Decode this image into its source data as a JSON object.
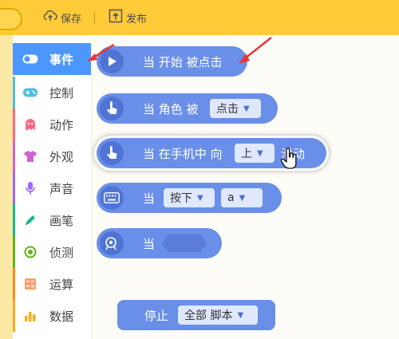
{
  "toolbar": {
    "save_label": "保存",
    "publish_label": "发布",
    "icon_save": "cloud-upload-icon",
    "icon_publish": "publish-icon"
  },
  "sidebar": {
    "items": [
      {
        "label": "事件",
        "icon": "toggle-icon",
        "color": "#4c97ff",
        "active": true
      },
      {
        "label": "控制",
        "icon": "gamepad-icon",
        "color": "#4cbfe6"
      },
      {
        "label": "动作",
        "icon": "ghost-icon",
        "color": "#ff6680"
      },
      {
        "label": "外观",
        "icon": "shirt-icon",
        "color": "#cf63cf"
      },
      {
        "label": "声音",
        "icon": "microphone-icon",
        "color": "#9966ff"
      },
      {
        "label": "画笔",
        "icon": "pen-icon",
        "color": "#0fbd8c"
      },
      {
        "label": "侦测",
        "icon": "target-icon",
        "color": "#5cb712"
      },
      {
        "label": "运算",
        "icon": "calculator-icon",
        "color": "#ff8c1a"
      },
      {
        "label": "数据",
        "icon": "bar-chart-icon",
        "color": "#ffab19"
      }
    ]
  },
  "blocks": {
    "start": {
      "text": "当 开始 被点击"
    },
    "sprite_click": {
      "text1": "当 角色 被",
      "dropdown": "点击"
    },
    "swipe": {
      "text1": "当 在手机中 向",
      "dropdown": "上",
      "text2": "滑动"
    },
    "key": {
      "text1": "当",
      "dropdown1": "按下",
      "dropdown2": "a"
    },
    "broadcast": {
      "text1": "当"
    },
    "stop": {
      "text1": "停止",
      "dropdown": "全部 脚本"
    }
  },
  "colors": {
    "toolbar": "#ffcb38",
    "block": "#6a8fe9",
    "active_category": "#4c97ff",
    "annotation_arrow": "#e53935"
  }
}
